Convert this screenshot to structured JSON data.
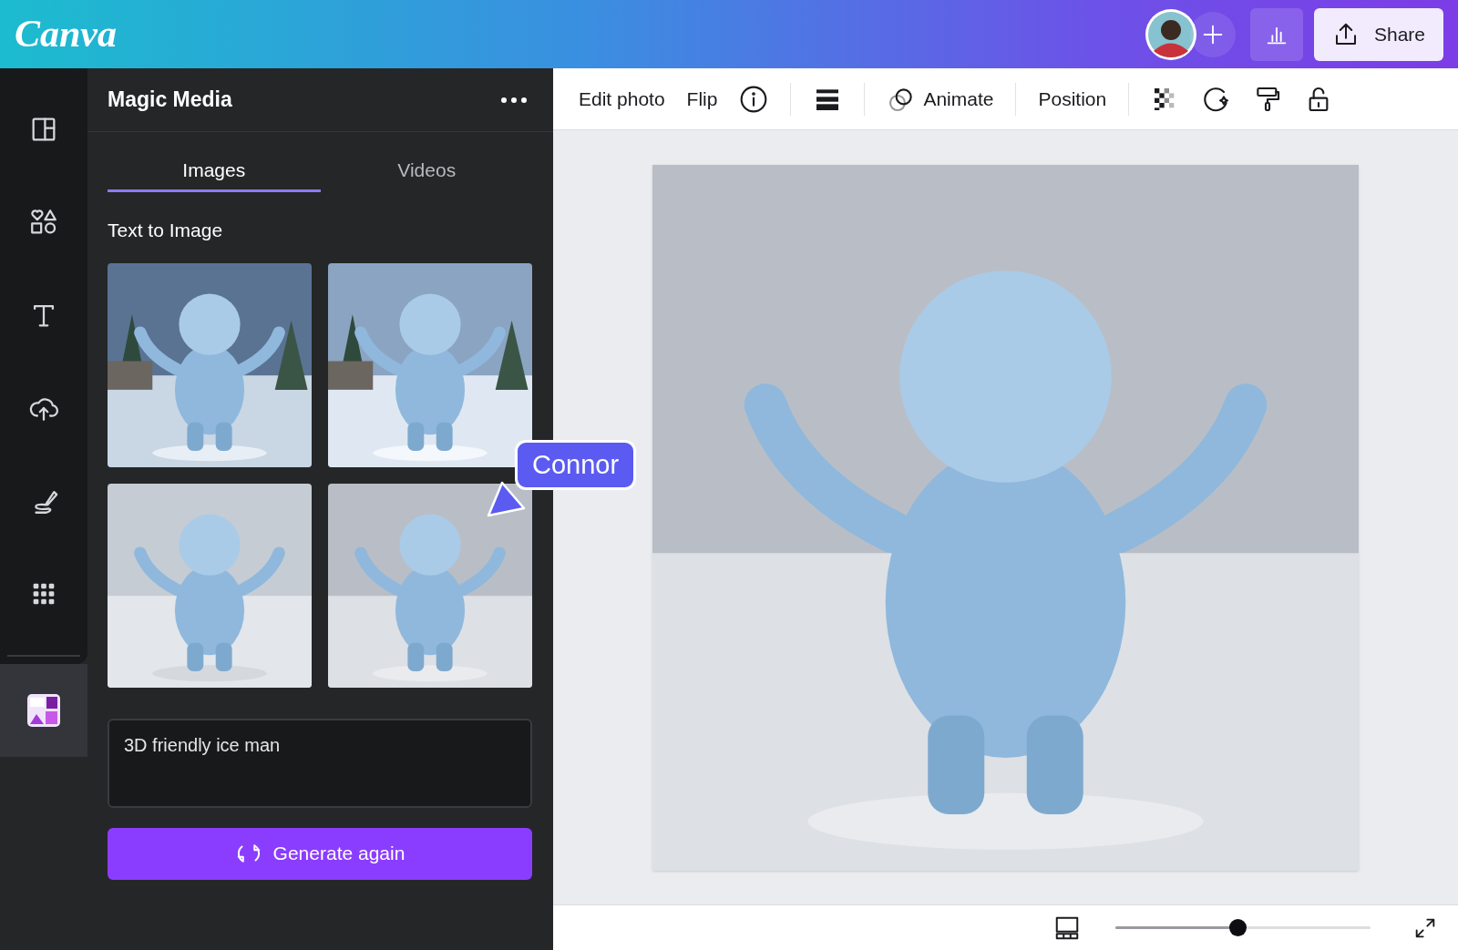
{
  "top_bar": {
    "logo": "Canva",
    "share_button": "Share"
  },
  "rail_items": [
    {
      "kind": "design",
      "selected": false
    },
    {
      "kind": "elements",
      "selected": false
    },
    {
      "kind": "text",
      "selected": false
    },
    {
      "kind": "uploads",
      "selected": false
    },
    {
      "kind": "draw",
      "selected": false
    },
    {
      "kind": "apps",
      "selected": false
    },
    {
      "kind": "magic",
      "selected": true
    }
  ],
  "panel": {
    "title": "Magic Media",
    "tabs": [
      {
        "label": "Images",
        "selected": true
      },
      {
        "label": "Videos",
        "selected": false
      }
    ],
    "section": "Text to Image",
    "prompt": "3D friendly ice man",
    "generate_button": "Generate again"
  },
  "cursor": {
    "label": "Connor"
  },
  "toolbar": [
    {
      "kind": "text",
      "label": "Edit photo"
    },
    {
      "kind": "text",
      "label": "Flip"
    },
    {
      "kind": "info"
    },
    {
      "kind": "divider"
    },
    {
      "kind": "spacing"
    },
    {
      "kind": "divider"
    },
    {
      "kind": "animate",
      "label": "Animate"
    },
    {
      "kind": "divider"
    },
    {
      "kind": "text",
      "label": "Position"
    },
    {
      "kind": "divider"
    },
    {
      "kind": "transparency"
    },
    {
      "kind": "magic"
    },
    {
      "kind": "paint"
    },
    {
      "kind": "lock"
    }
  ],
  "bottom_bar": {
    "zoom": {
      "level": 0.48
    }
  }
}
